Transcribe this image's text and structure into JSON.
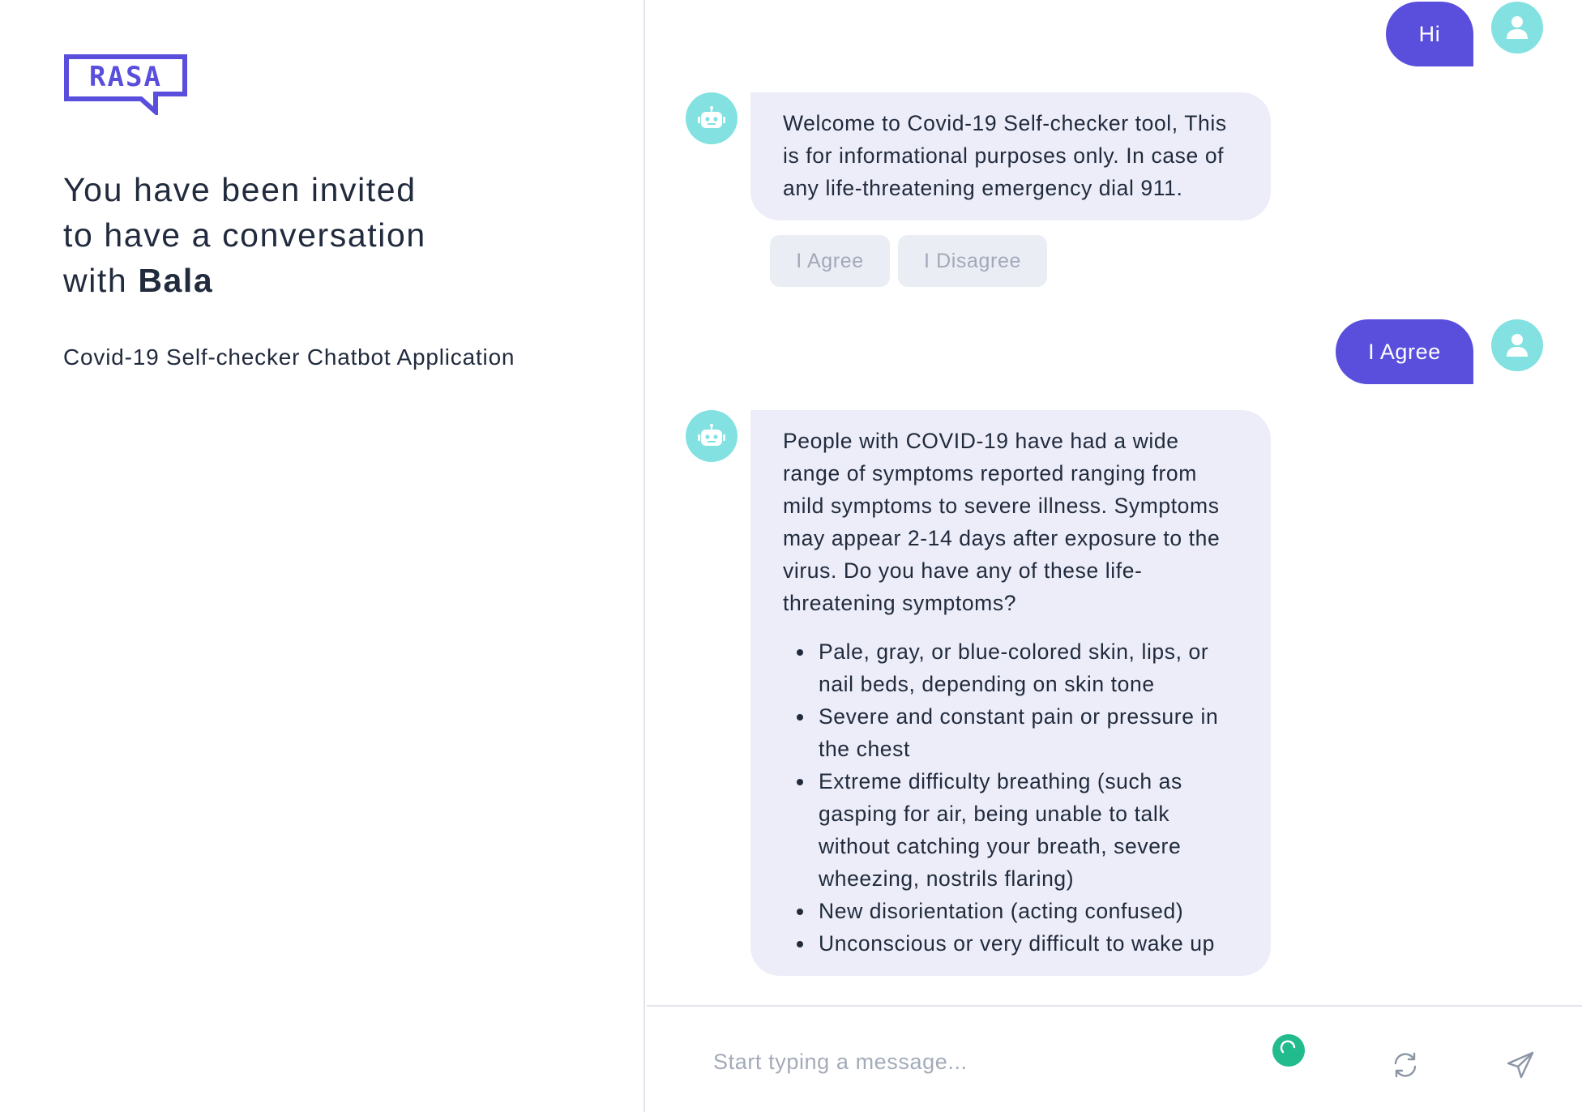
{
  "brand": {
    "logo_text": "RASA",
    "accent_color": "#5a4fdc"
  },
  "intro": {
    "line1": "You have been invited",
    "line2": "to have a conversation",
    "line3_prefix": "with ",
    "bot_name": "Bala",
    "subtitle": "Covid-19 Self-checker Chatbot Application"
  },
  "conversation": {
    "user_msg_1": "Hi",
    "bot_msg_1": "Welcome to Covid-19 Self-checker tool, This is for informational purposes only. In case of any life-threatening emergency dial 911.",
    "quick_replies": [
      "I Agree",
      "I Disagree"
    ],
    "user_msg_2": "I Agree",
    "bot_msg_2": {
      "text": "People with COVID-19 have had a wide range of symptoms reported ranging from mild symptoms to severe illness. Symptoms may appear 2-14 days after exposure to the virus. Do you have any of these life-threatening symptoms?",
      "symptoms": [
        "Pale, gray, or blue-colored skin, lips, or nail beds, depending on skin tone",
        "Severe and constant pain or pressure in the chest",
        "Extreme difficulty breathing (such as gasping for air, being unable to talk without catching your breath, severe wheezing, nostrils flaring)",
        "New disorientation (acting confused)",
        "Unconscious or very difficult to wake up"
      ]
    }
  },
  "composer": {
    "placeholder": "Start typing a message...",
    "icons": [
      "status-indicator",
      "refresh-icon",
      "send-icon"
    ]
  }
}
